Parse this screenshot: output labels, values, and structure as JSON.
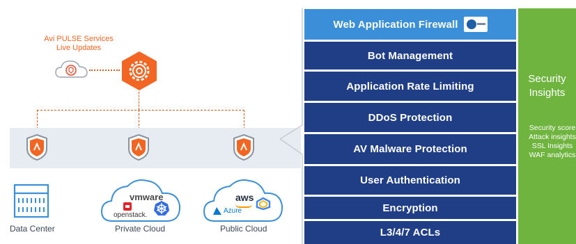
{
  "pulse": {
    "label_line1": "Avi PULSE Services",
    "label_line2": "Live Updates"
  },
  "environments": {
    "data_center": "Data Center",
    "private_cloud": "Private Cloud",
    "public_cloud": "Public Cloud",
    "vmware": "vmware",
    "openstack": "openstack.",
    "aws": "aws",
    "azure": "Azure"
  },
  "stack": {
    "layers": [
      "Web Application Firewall",
      "Bot Management",
      "Application Rate Limiting",
      "DDoS Protection",
      "AV Malware Protection",
      "User Authentication",
      "Encryption",
      "L3/4/7 ACLs"
    ]
  },
  "insights": {
    "title_line1": "Security",
    "title_line2": "Insights",
    "items": [
      "Security score",
      "Attack insights",
      "SSL Insights",
      "WAF analytics"
    ]
  },
  "colors": {
    "orange": "#f26522",
    "dark_blue": "#1f3e86",
    "light_blue": "#3a8fd8",
    "green": "#6fb43f"
  }
}
